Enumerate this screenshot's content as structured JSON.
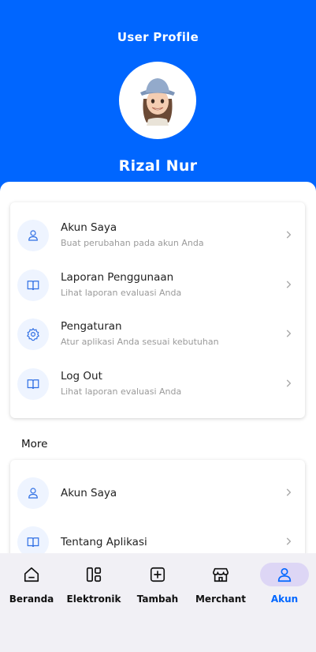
{
  "header": {
    "title": "User Profile",
    "user_name": "Rizal Nur",
    "accent_color": "#0066ff"
  },
  "menu_main": [
    {
      "icon": "user-icon",
      "title": "Akun Saya",
      "subtitle": "Buat perubahan pada akun Anda"
    },
    {
      "icon": "book-icon",
      "title": "Laporan Penggunaan",
      "subtitle": "Lihat laporan evaluasi Anda"
    },
    {
      "icon": "gear-icon",
      "title": "Pengaturan",
      "subtitle": "Atur aplikasi Anda sesuai kebutuhan"
    },
    {
      "icon": "book-icon",
      "title": "Log Out",
      "subtitle": "Lihat laporan evaluasi Anda"
    }
  ],
  "more": {
    "label": "More",
    "items": [
      {
        "icon": "user-icon",
        "title": "Akun Saya"
      },
      {
        "icon": "book-icon",
        "title": "Tentang Aplikasi"
      }
    ]
  },
  "nav": {
    "items": [
      {
        "icon": "home-icon",
        "label": "Beranda"
      },
      {
        "icon": "grid-icon",
        "label": "Elektronik"
      },
      {
        "icon": "plus-square-icon",
        "label": "Tambah"
      },
      {
        "icon": "store-icon",
        "label": "Merchant"
      },
      {
        "icon": "user-icon",
        "label": "Akun"
      }
    ],
    "active": "Akun"
  }
}
